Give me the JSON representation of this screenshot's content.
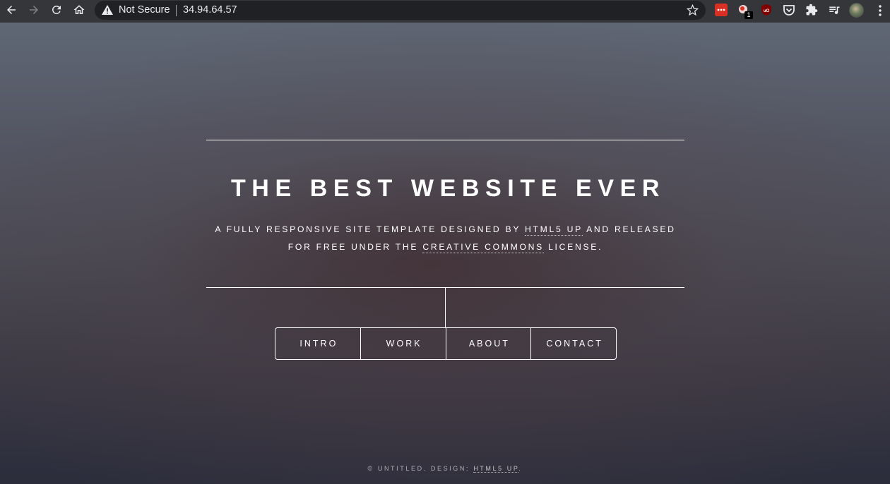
{
  "browser": {
    "security_label": "Not Secure",
    "url": "34.94.64.57",
    "extension_badge": "1",
    "icons": [
      "back-icon",
      "forward-icon",
      "reload-icon",
      "home-icon",
      "warning-icon",
      "star-icon",
      "puzzle-icon",
      "media-icon",
      "menu-icon"
    ]
  },
  "hero": {
    "title": "THE BEST WEBSITE EVER",
    "subtitle_part1": "A FULLY RESPONSIVE SITE TEMPLATE DESIGNED BY ",
    "subtitle_link1": "HTML5 UP",
    "subtitle_part2": " AND RELEASED",
    "subtitle_part3": "FOR FREE UNDER THE ",
    "subtitle_link2": "CREATIVE COMMONS",
    "subtitle_part4": " LICENSE."
  },
  "nav": {
    "items": [
      {
        "label": "INTRO"
      },
      {
        "label": "WORK"
      },
      {
        "label": "ABOUT"
      },
      {
        "label": "CONTACT"
      }
    ]
  },
  "footer": {
    "text": "© UNTITLED. DESIGN: ",
    "link": "HTML5 UP",
    "suffix": "."
  },
  "colors": {
    "chrome_bg": "#35363a",
    "omnibox_bg": "#202124",
    "text": "#ffffff"
  }
}
